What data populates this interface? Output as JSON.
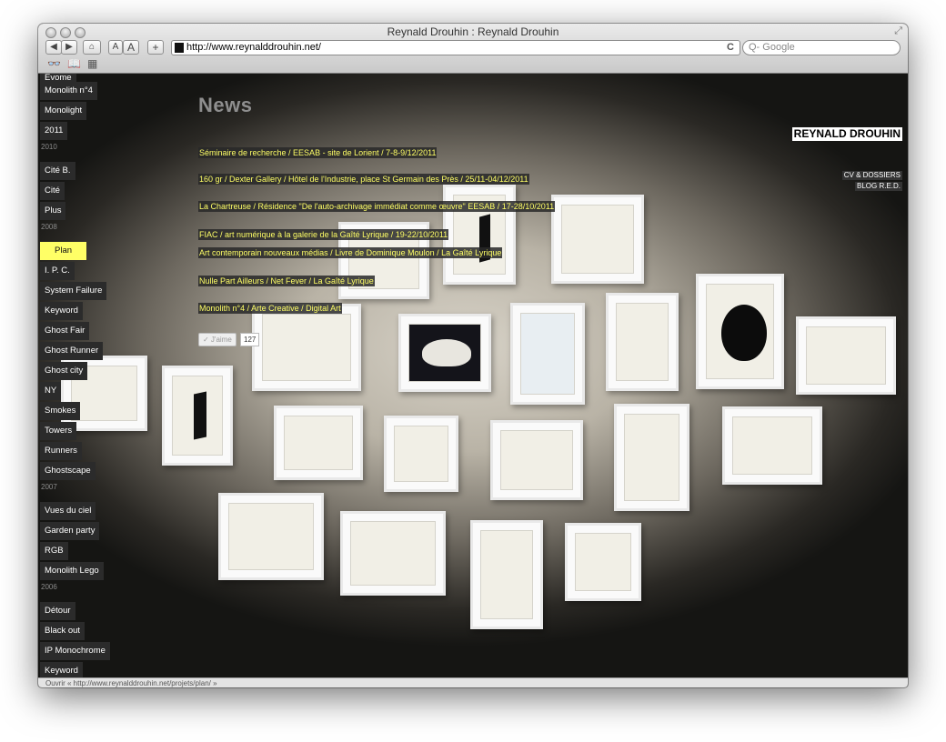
{
  "window": {
    "title": "Reynald Drouhin : Reynald Drouhin"
  },
  "toolbar": {
    "text_small": "A",
    "text_large": "A",
    "add_label": "+",
    "address": "http://www.reynalddrouhin.net/",
    "reload_glyph": "C",
    "search_placeholder": "Q- Google"
  },
  "sidebar": {
    "partial_item": "Evome",
    "groups": [
      {
        "year": "",
        "items": [
          "Monolith n°4",
          "Monolight",
          "2011"
        ]
      },
      {
        "year": "2010",
        "items": [
          "Cité B.",
          "Cité",
          "Plus"
        ]
      },
      {
        "year": "2008",
        "items": [
          "Plan",
          "I. P. C.",
          "System Failure",
          "Keyword",
          "Ghost Fair",
          "Ghost Runner",
          "Ghost city",
          "NY",
          "Smokes",
          "Towers",
          "Runners",
          "Ghostscape"
        ]
      },
      {
        "year": "2007",
        "items": [
          "Vues du ciel",
          "Garden party",
          "RGB",
          "Monolith Lego"
        ]
      },
      {
        "year": "2006",
        "items": [
          "Détour",
          "Black out",
          "IP Monochrome",
          "Keyword"
        ]
      }
    ],
    "active_item": "Plan"
  },
  "news": {
    "heading": "News",
    "items": [
      "Séminaire de recherche / EESAB - site de Lorient / 7-8-9/12/2011",
      "160 gr / Dexter Gallery / Hôtel de l'Industrie, place St Germain des Près / 25/11-04/12/2011",
      "La Chartreuse / Résidence \"De l'auto-archivage immédiat comme œuvre\" EESAB / 17-28/10/2011",
      "FIAC / art numérique à la galerie de la Gaîté Lyrique / 19-22/10/2011",
      "Art contemporain nouveaux médias / Livre de Dominique Moulon / La Gaîté Lyrique",
      "Nulle Part Ailleurs / Net Fever / La Gaîté Lyrique",
      "Monolith n°4 / Arte Creative / Digital Art"
    ],
    "like_label": "✓ J'aime",
    "like_count": "127"
  },
  "brand": {
    "name": "REYNALD DROUHIN",
    "links": [
      "CV & DOSSIERS",
      "BLOG R.E.D."
    ]
  },
  "status": {
    "text": "Ouvrir « http://www.reynalddrouhin.net/projets/plan/ »"
  },
  "colors": {
    "highlight": "#ffff66",
    "menu_bg": "#2b2b2b"
  }
}
